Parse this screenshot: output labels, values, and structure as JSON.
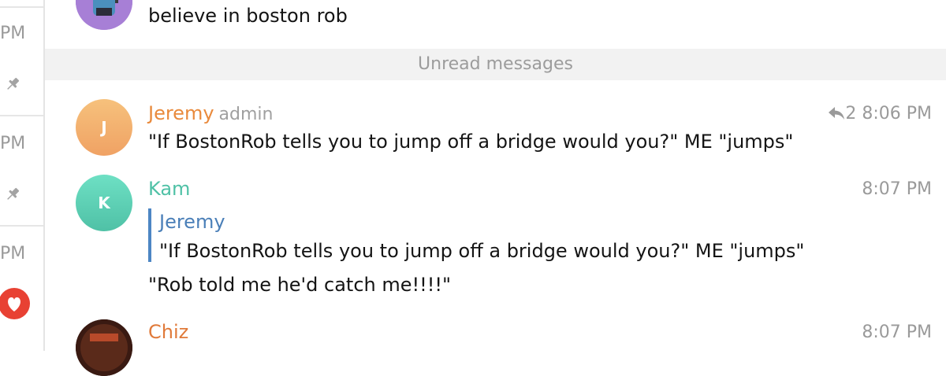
{
  "rail": {
    "times": [
      "PM",
      "PM",
      "PM"
    ]
  },
  "messages": {
    "prev": {
      "text": "believe in boston rob"
    },
    "unread_label": "Unread messages",
    "jeremy": {
      "avatar_letter": "J",
      "author": "Jeremy",
      "role": "admin",
      "reply_count": "2",
      "time": "8:06 PM",
      "text": "\"If BostonRob tells you to jump off a bridge would you?\" ME \"jumps\""
    },
    "kam": {
      "avatar_letter": "K",
      "author": "Kam",
      "time": "8:07 PM",
      "quote_author": "Jeremy",
      "quote_text": "\"If BostonRob tells you to jump off a bridge would you?\" ME \"jumps\"",
      "text": "\"Rob told me he'd catch me!!!!\""
    },
    "chiz": {
      "author": "Chiz",
      "time": "8:07 PM"
    }
  },
  "colors": {
    "jeremy_name": "#e98a3c",
    "kam_name": "#4fc1a6",
    "chiz_name": "#e07a3a",
    "quote_accent": "#4d86c4",
    "heart": "#e84133"
  },
  "icons": {
    "pin": "pin-icon",
    "reply": "reply-icon",
    "heart": "heart-icon"
  }
}
